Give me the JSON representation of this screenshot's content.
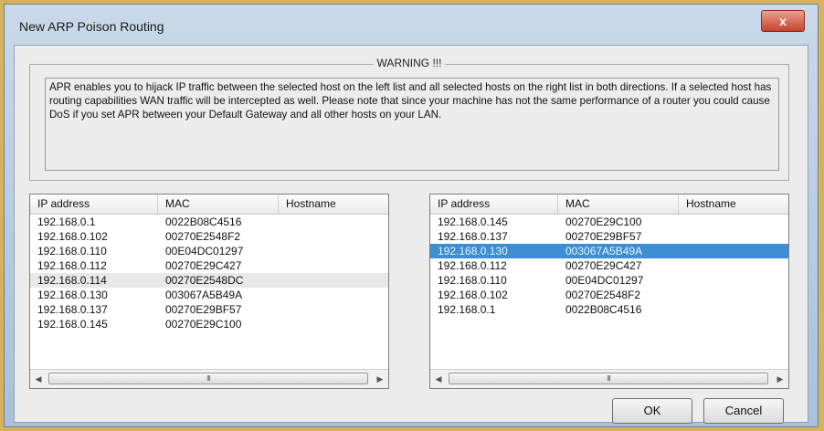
{
  "window": {
    "title": "New ARP Poison Routing",
    "close_glyph": "x"
  },
  "warning": {
    "legend": "WARNING !!!",
    "text": "APR enables you to hijack IP traffic between the selected host on the left list and all selected hosts on the right list in both directions. If a selected host has routing capabilities WAN traffic will be intercepted as well. Please note that since your machine has not the same performance of a router you could cause DoS if you set APR between your Default Gateway and all other hosts on your LAN."
  },
  "columns": [
    "IP address",
    "MAC",
    "Hostname"
  ],
  "left_list": {
    "rows": [
      {
        "ip": "192.168.0.1",
        "mac": "0022B08C4516"
      },
      {
        "ip": "192.168.0.102",
        "mac": "00270E2548F2"
      },
      {
        "ip": "192.168.0.110",
        "mac": "00E04DC01297"
      },
      {
        "ip": "192.168.0.112",
        "mac": "00270E29C427"
      },
      {
        "ip": "192.168.0.114",
        "mac": "00270E2548DC"
      },
      {
        "ip": "192.168.0.130",
        "mac": "003067A5B49A"
      },
      {
        "ip": "192.168.0.137",
        "mac": "00270E29BF57"
      },
      {
        "ip": "192.168.0.145",
        "mac": "00270E29C100"
      }
    ],
    "hover_row": 4
  },
  "right_list": {
    "rows": [
      {
        "ip": "192.168.0.145",
        "mac": "00270E29C100"
      },
      {
        "ip": "192.168.0.137",
        "mac": "00270E29BF57"
      },
      {
        "ip": "192.168.0.130",
        "mac": "003067A5B49A"
      },
      {
        "ip": "192.168.0.112",
        "mac": "00270E29C427"
      },
      {
        "ip": "192.168.0.110",
        "mac": "00E04DC01297"
      },
      {
        "ip": "192.168.0.102",
        "mac": "00270E2548F2"
      },
      {
        "ip": "192.168.0.1",
        "mac": "0022B08C4516"
      }
    ],
    "selected_row": 2
  },
  "scrollbar": {
    "grip": "III"
  },
  "buttons": {
    "ok": "OK",
    "cancel": "Cancel"
  },
  "colors": {
    "selection": "#3d8ed2",
    "close_button": "#c8432b"
  }
}
